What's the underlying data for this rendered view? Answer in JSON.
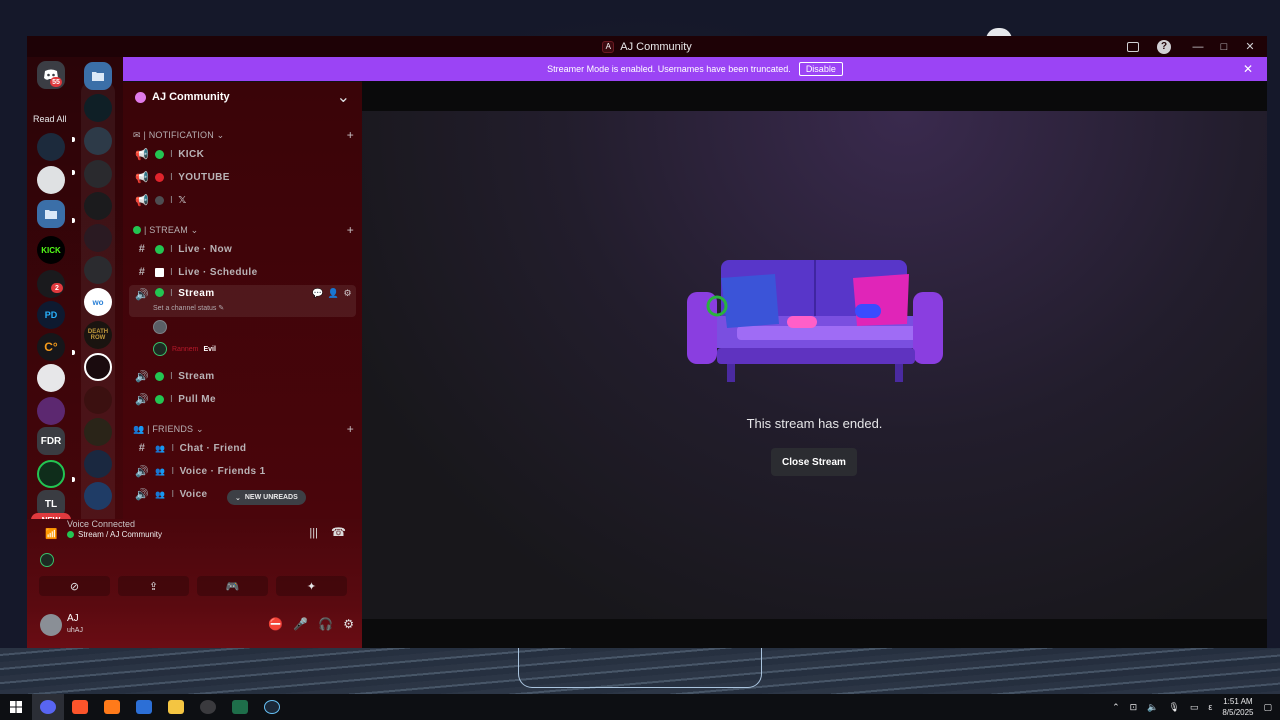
{
  "window": {
    "title": "AJ Community",
    "title_badge": "A",
    "controls": [
      "inbox-icon",
      "help-icon",
      "minimize-icon",
      "maximize-icon",
      "close-icon"
    ],
    "help_glyph": "?",
    "minimize_glyph": "—",
    "maximize_glyph": "□",
    "close_glyph": "✕"
  },
  "banner": {
    "text": "Streamer Mode is enabled. Usernames have been truncated.",
    "button": "Disable",
    "close_glyph": "✕",
    "color": "#9b44f5"
  },
  "rail": {
    "dm_badge": "55",
    "read_all": "Read All",
    "mention_2": "2",
    "new_pill": "NEW",
    "labels": {
      "kick": "KICK",
      "pd": "PD",
      "c": "C°",
      "fdr": "FDR",
      "tl": "TL",
      "wo": "wo",
      "death_row": "DEATH ROW"
    }
  },
  "server": {
    "name": "AJ Community",
    "chevron": "⌄"
  },
  "categories": {
    "notification": "| NOTIFICATION ⌄",
    "stream": "| STREAM ⌄",
    "friends": "| FRIENDS ⌄",
    "plus": "+"
  },
  "channels": {
    "kick": "KICK",
    "youtube": "YOUTUBE",
    "x": "𝕏",
    "live_now": "Live · Now",
    "live_schedule": "Live · Schedule",
    "stream_active": "Stream",
    "stream_status": "Set a channel status ✎",
    "stream2": "Stream",
    "pull_me": "Pull Me",
    "chat_friend": "Chat · Friend",
    "voice_friends": "Voice · Friends 1",
    "voice_partial": "Voice",
    "sep": "I"
  },
  "voice_users": {
    "user2_name": "Rannem",
    "user2_tag": "Evil"
  },
  "new_unreads": "NEW UNREADS",
  "voice_panel": {
    "title": "Voice Connected",
    "sub": "Stream / AJ Community"
  },
  "user": {
    "name": "AJ",
    "sub": "uhAJ"
  },
  "stage": {
    "ended_text": "This stream has ended.",
    "close_button": "Close Stream"
  },
  "taskbar": {
    "time": "1:51 AM",
    "date": "8/5/2025",
    "lang": "ε"
  }
}
